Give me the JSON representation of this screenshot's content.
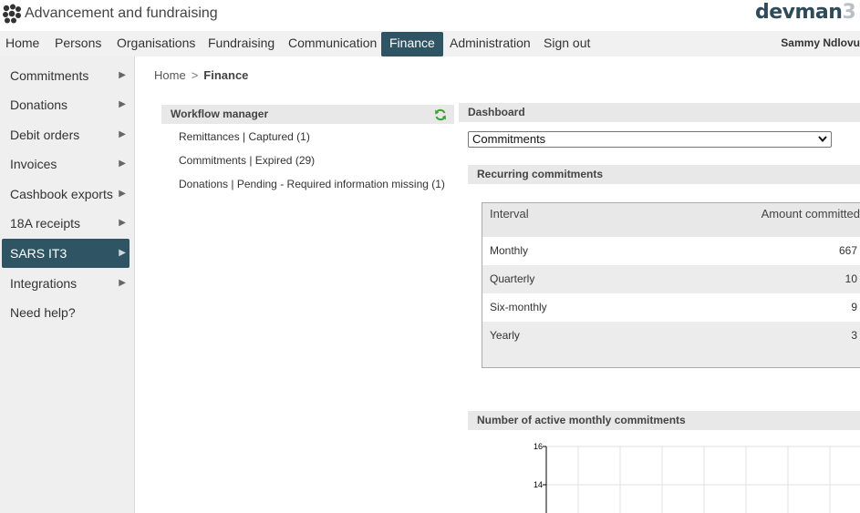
{
  "app": {
    "title": "Advancement and fundraising",
    "brand": "devman",
    "brand_suffix": "3"
  },
  "nav": {
    "items": [
      "Home",
      "Persons",
      "Organisations",
      "Fundraising",
      "Communication",
      "Finance",
      "Administration",
      "Sign out"
    ],
    "active": "Finance",
    "user": "Sammy Ndlovu"
  },
  "sidebar": {
    "items": [
      {
        "label": "Commitments",
        "arrow": "▶"
      },
      {
        "label": "Donations",
        "arrow": "▶"
      },
      {
        "label": "Debit orders",
        "arrow": "▶"
      },
      {
        "label": "Invoices",
        "arrow": "▶"
      },
      {
        "label": "Cashbook exports",
        "arrow": "▶"
      },
      {
        "label": "18A receipts",
        "arrow": "▶"
      },
      {
        "label": "SARS IT3",
        "arrow": "▶"
      },
      {
        "label": "Integrations",
        "arrow": "▶"
      },
      {
        "label": "Need help?",
        "arrow": ""
      }
    ],
    "active": "SARS IT3"
  },
  "breadcrumb": {
    "home": "Home",
    "separator": ">",
    "current": "Finance"
  },
  "workflow": {
    "title": "Workflow manager",
    "items": [
      "Remittances | Captured (1)",
      "Commitments | Expired (29)",
      "Donations | Pending - Required information missing (1)"
    ]
  },
  "dashboard": {
    "title": "Dashboard",
    "select_value": "Commitments",
    "recurring_title": "Recurring commitments",
    "table": {
      "headers": [
        "Interval",
        "Amount committed"
      ],
      "rows": [
        [
          "Monthly",
          "667"
        ],
        [
          "Quarterly",
          "10"
        ],
        [
          "Six-monthly",
          "9"
        ],
        [
          "Yearly",
          "3"
        ]
      ]
    },
    "chart_title": "Number of active monthly commitments"
  },
  "chart_data": {
    "type": "line",
    "title": "Number of active monthly commitments",
    "y_ticks": [
      16,
      14
    ],
    "ylim": [
      12,
      16
    ],
    "grid": true,
    "series": []
  },
  "colors": {
    "accent": "#2f5464",
    "refresh": "#3aa335",
    "brand": "#2f4b59"
  },
  "icons": {
    "app_logo": "dots-logo-icon",
    "refresh": "refresh-icon",
    "arrow": "triangle-right-icon",
    "select": "chevron-down-icon"
  }
}
